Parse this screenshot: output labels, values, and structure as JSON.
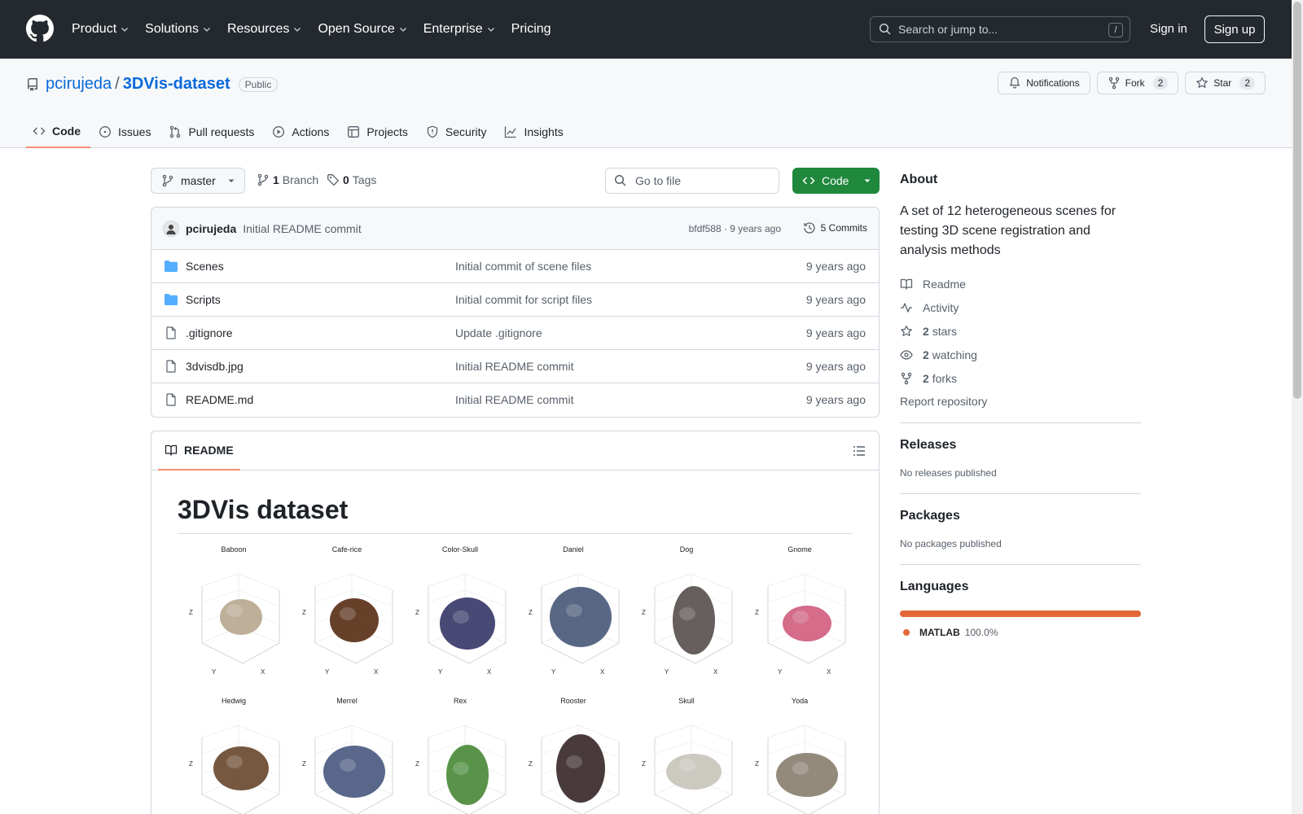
{
  "header": {
    "nav": [
      "Product",
      "Solutions",
      "Resources",
      "Open Source",
      "Enterprise",
      "Pricing"
    ],
    "search_placeholder": "Search or jump to...",
    "search_shortcut": "/",
    "signin": "Sign in",
    "signup": "Sign up"
  },
  "repo": {
    "owner": "pcirujeda",
    "separator": "/",
    "name": "3DVis-dataset",
    "visibility": "Public",
    "notifications": "Notifications",
    "fork_label": "Fork",
    "fork_count": "2",
    "star_label": "Star",
    "star_count": "2"
  },
  "tabs": [
    "Code",
    "Issues",
    "Pull requests",
    "Actions",
    "Projects",
    "Security",
    "Insights"
  ],
  "toolbar": {
    "branch": "master",
    "branch_count": "1",
    "branch_label": "Branch",
    "tag_count": "0",
    "tag_label": "Tags",
    "goto_placeholder": "Go to file",
    "code_label": "Code"
  },
  "commit": {
    "author": "pcirujeda",
    "message": "Initial README commit",
    "meta": "bfdf588 · 9 years ago",
    "count": "5 Commits"
  },
  "files": [
    {
      "name": "Scenes",
      "type": "folder",
      "message": "Initial commit of scene files",
      "date": "9 years ago"
    },
    {
      "name": "Scripts",
      "type": "folder",
      "message": "Initial commit for script files",
      "date": "9 years ago"
    },
    {
      "name": ".gitignore",
      "type": "file",
      "message": "Update .gitignore",
      "date": "9 years ago"
    },
    {
      "name": "3dvisdb.jpg",
      "type": "file",
      "message": "Initial README commit",
      "date": "9 years ago"
    },
    {
      "name": "README.md",
      "type": "file",
      "message": "Initial README commit",
      "date": "9 years ago"
    }
  ],
  "readme": {
    "tab": "README",
    "title": "3DVis dataset",
    "scenes": [
      "Baboon",
      "Cafe-rice",
      "Color-Skull",
      "Daniel",
      "Dog",
      "Gnome",
      "Hedwig",
      "Merrel",
      "Rex",
      "Rooster",
      "Skull",
      "Yoda"
    ],
    "scene_colors": [
      "#b8a890",
      "#5a3018",
      "#3a3a6a",
      "#4a5a7a",
      "#5a5050",
      "#d06080",
      "#6a4a30",
      "#4a5a80",
      "#4a8a3a",
      "#3a2a2a",
      "#c8c4bc",
      "#8a8070"
    ]
  },
  "sidebar": {
    "about": "About",
    "description": "A set of 12 heterogeneous scenes for testing 3D scene registration and analysis methods",
    "readme": "Readme",
    "activity": "Activity",
    "stars_count": "2",
    "stars_label": "stars",
    "watching_count": "2",
    "watching_label": "watching",
    "forks_count": "2",
    "forks_label": "forks",
    "report": "Report repository",
    "releases_h": "Releases",
    "releases_p": "No releases published",
    "packages_h": "Packages",
    "packages_p": "No packages published",
    "languages_h": "Languages",
    "lang_name": "MATLAB",
    "lang_pct": "100.0%",
    "lang_color": "#e16737"
  }
}
